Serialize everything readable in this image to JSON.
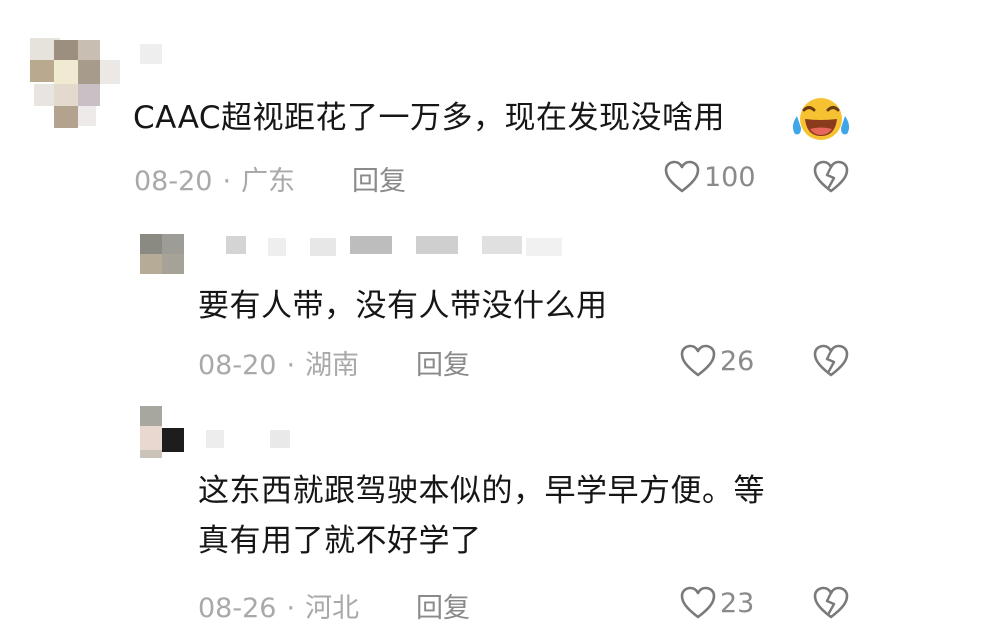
{
  "comments": [
    {
      "text": "CAAC超视距花了一万多，现在发现没啥用",
      "emoji": "laughing-crying-emoji",
      "date": "08-20",
      "location": "广东",
      "reply_label": "回复",
      "likes": "100"
    },
    {
      "text": "要有人带，没有人带没什么用",
      "date": "08-20",
      "location": "湖南",
      "reply_label": "回复",
      "likes": "26"
    },
    {
      "text_line1": "这东西就跟驾驶本似的，早学早方便。等",
      "text_line2": "真有用了就不好学了",
      "date": "08-26",
      "location": "河北",
      "reply_label": "回复",
      "likes": "23"
    }
  ],
  "separator": "·",
  "icons": {
    "like": "heart-outline-icon",
    "dislike": "broken-heart-icon"
  }
}
